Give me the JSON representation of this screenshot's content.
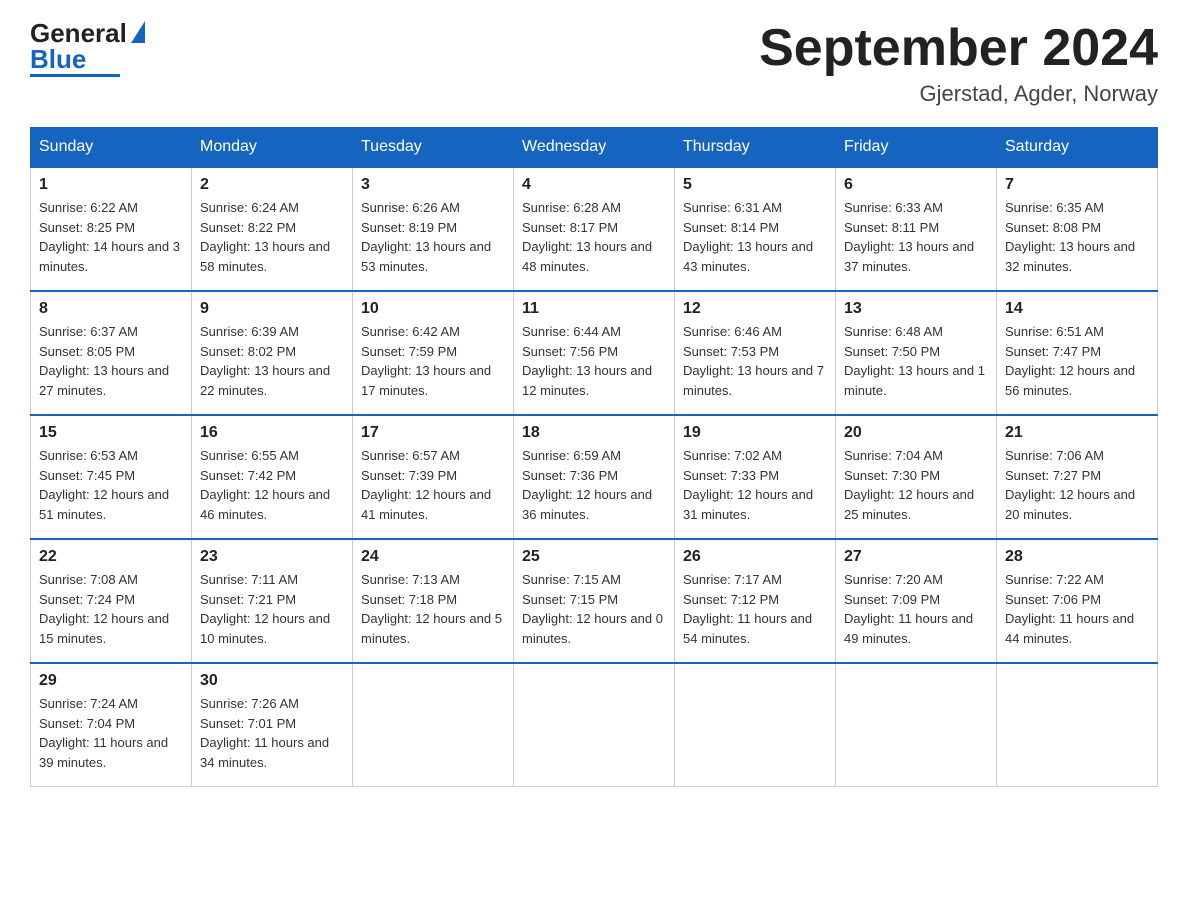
{
  "logo": {
    "general": "General",
    "blue_text": "Blue",
    "triangle": "▶"
  },
  "header": {
    "month_year": "September 2024",
    "location": "Gjerstad, Agder, Norway"
  },
  "weekdays": [
    "Sunday",
    "Monday",
    "Tuesday",
    "Wednesday",
    "Thursday",
    "Friday",
    "Saturday"
  ],
  "weeks": [
    [
      {
        "day": "1",
        "sunrise": "6:22 AM",
        "sunset": "8:25 PM",
        "daylight": "14 hours and 3 minutes."
      },
      {
        "day": "2",
        "sunrise": "6:24 AM",
        "sunset": "8:22 PM",
        "daylight": "13 hours and 58 minutes."
      },
      {
        "day": "3",
        "sunrise": "6:26 AM",
        "sunset": "8:19 PM",
        "daylight": "13 hours and 53 minutes."
      },
      {
        "day": "4",
        "sunrise": "6:28 AM",
        "sunset": "8:17 PM",
        "daylight": "13 hours and 48 minutes."
      },
      {
        "day": "5",
        "sunrise": "6:31 AM",
        "sunset": "8:14 PM",
        "daylight": "13 hours and 43 minutes."
      },
      {
        "day": "6",
        "sunrise": "6:33 AM",
        "sunset": "8:11 PM",
        "daylight": "13 hours and 37 minutes."
      },
      {
        "day": "7",
        "sunrise": "6:35 AM",
        "sunset": "8:08 PM",
        "daylight": "13 hours and 32 minutes."
      }
    ],
    [
      {
        "day": "8",
        "sunrise": "6:37 AM",
        "sunset": "8:05 PM",
        "daylight": "13 hours and 27 minutes."
      },
      {
        "day": "9",
        "sunrise": "6:39 AM",
        "sunset": "8:02 PM",
        "daylight": "13 hours and 22 minutes."
      },
      {
        "day": "10",
        "sunrise": "6:42 AM",
        "sunset": "7:59 PM",
        "daylight": "13 hours and 17 minutes."
      },
      {
        "day": "11",
        "sunrise": "6:44 AM",
        "sunset": "7:56 PM",
        "daylight": "13 hours and 12 minutes."
      },
      {
        "day": "12",
        "sunrise": "6:46 AM",
        "sunset": "7:53 PM",
        "daylight": "13 hours and 7 minutes."
      },
      {
        "day": "13",
        "sunrise": "6:48 AM",
        "sunset": "7:50 PM",
        "daylight": "13 hours and 1 minute."
      },
      {
        "day": "14",
        "sunrise": "6:51 AM",
        "sunset": "7:47 PM",
        "daylight": "12 hours and 56 minutes."
      }
    ],
    [
      {
        "day": "15",
        "sunrise": "6:53 AM",
        "sunset": "7:45 PM",
        "daylight": "12 hours and 51 minutes."
      },
      {
        "day": "16",
        "sunrise": "6:55 AM",
        "sunset": "7:42 PM",
        "daylight": "12 hours and 46 minutes."
      },
      {
        "day": "17",
        "sunrise": "6:57 AM",
        "sunset": "7:39 PM",
        "daylight": "12 hours and 41 minutes."
      },
      {
        "day": "18",
        "sunrise": "6:59 AM",
        "sunset": "7:36 PM",
        "daylight": "12 hours and 36 minutes."
      },
      {
        "day": "19",
        "sunrise": "7:02 AM",
        "sunset": "7:33 PM",
        "daylight": "12 hours and 31 minutes."
      },
      {
        "day": "20",
        "sunrise": "7:04 AM",
        "sunset": "7:30 PM",
        "daylight": "12 hours and 25 minutes."
      },
      {
        "day": "21",
        "sunrise": "7:06 AM",
        "sunset": "7:27 PM",
        "daylight": "12 hours and 20 minutes."
      }
    ],
    [
      {
        "day": "22",
        "sunrise": "7:08 AM",
        "sunset": "7:24 PM",
        "daylight": "12 hours and 15 minutes."
      },
      {
        "day": "23",
        "sunrise": "7:11 AM",
        "sunset": "7:21 PM",
        "daylight": "12 hours and 10 minutes."
      },
      {
        "day": "24",
        "sunrise": "7:13 AM",
        "sunset": "7:18 PM",
        "daylight": "12 hours and 5 minutes."
      },
      {
        "day": "25",
        "sunrise": "7:15 AM",
        "sunset": "7:15 PM",
        "daylight": "12 hours and 0 minutes."
      },
      {
        "day": "26",
        "sunrise": "7:17 AM",
        "sunset": "7:12 PM",
        "daylight": "11 hours and 54 minutes."
      },
      {
        "day": "27",
        "sunrise": "7:20 AM",
        "sunset": "7:09 PM",
        "daylight": "11 hours and 49 minutes."
      },
      {
        "day": "28",
        "sunrise": "7:22 AM",
        "sunset": "7:06 PM",
        "daylight": "11 hours and 44 minutes."
      }
    ],
    [
      {
        "day": "29",
        "sunrise": "7:24 AM",
        "sunset": "7:04 PM",
        "daylight": "11 hours and 39 minutes."
      },
      {
        "day": "30",
        "sunrise": "7:26 AM",
        "sunset": "7:01 PM",
        "daylight": "11 hours and 34 minutes."
      },
      null,
      null,
      null,
      null,
      null
    ]
  ]
}
